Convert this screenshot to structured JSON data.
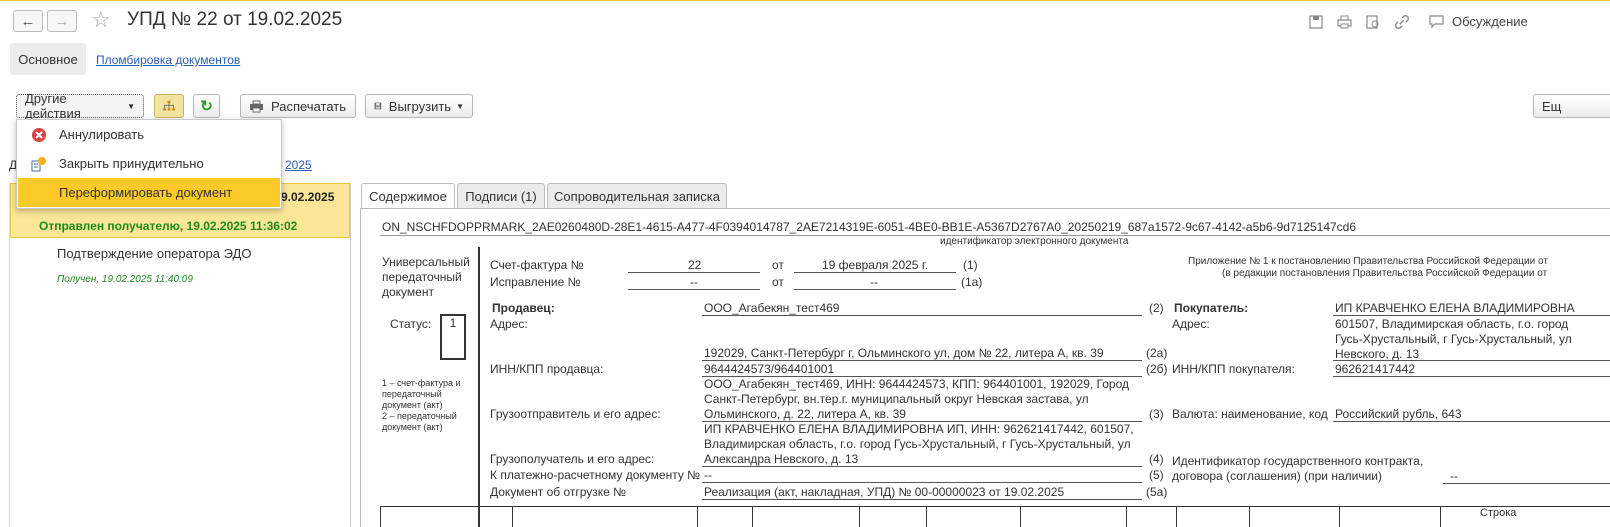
{
  "header": {
    "title": "УПД № 22 от 19.02.2025",
    "discussion": "Обсуждение"
  },
  "nav": {
    "back_glyph": "←",
    "forward_glyph": "→",
    "star_glyph": "☆"
  },
  "tabs": {
    "main": "Основное",
    "sealing": "Пломбировка документов"
  },
  "toolbar": {
    "more_actions": "Другие действия",
    "print": "Распечатать",
    "export": "Выгрузить",
    "right_truncated": "Ещ"
  },
  "menu": {
    "items": [
      "Аннулировать",
      "Закрыть принудительно",
      "Переформировать документ"
    ]
  },
  "left": {
    "partial_top": "Д",
    "partial_link": "2025",
    "selected_partial": "9.02.2025",
    "selected_status": "Отправлен получателю, 19.02.2025 11:36:02",
    "item2_title": "Подтверждение оператора ЭДО",
    "item2_status": "Получен, 19.02.2025 11:40:09"
  },
  "doc_tabs": [
    "Содержимое",
    "Подписи (1)",
    "Сопроводительная записка"
  ],
  "doc": {
    "file_id": "ON_NSCHFDOPPRMARK_2AE0260480D-28E1-4615-A477-4F0394014787_2AE7214319E-6051-4BE0-BB1E-A5367D2767A0_20250219_687a1572-9c67-4142-a5b6-9d7125147cd6",
    "file_id_caption": "идентификатор электронного документа",
    "doc_type": [
      "Универсальный",
      "передаточный",
      "документ"
    ],
    "status_label": "Статус:",
    "status_value": "1",
    "status_note": [
      "1 – счет-фактура и",
      "передаточный",
      "документ (акт)",
      "2 – передаточный",
      "документ (акт)"
    ],
    "invoice_label": "Счет-фактура №",
    "invoice_no": "22",
    "from": "от",
    "invoice_date": "19 февраля 2025 г.",
    "code1": "(1)",
    "correction_label": "Исправление №",
    "correction_no": "--",
    "correction_date": "--",
    "code1a": "(1а)",
    "appendix1": "Приложение № 1 к постановлению Правительства Российской Федерации от",
    "appendix2": "(в редакции постановления Правительства Российской Федерации от",
    "seller_label": "Продавец:",
    "seller": "ООО_Агабекян_тест469",
    "code2": "(2)",
    "address_label": "Адрес:",
    "seller_address": "192029, Санкт-Петербург г, Ольминского ул, дом № 22, литера А, кв. 39",
    "code2a": "(2а)",
    "seller_inn_label": "ИНН/КПП продавца:",
    "seller_inn": "9644424573/964401001",
    "code2b": "(2б)",
    "shipper_label": "Грузоотправитель и его адрес:",
    "shipper": [
      "ООО_Агабекян_тест469, ИНН: 9644424573, КПП: 964401001, 192029, Город",
      "Санкт-Петербург, вн.тер.г. муниципальный округ Невская застава, ул",
      "Ольминского, д. 22, литера А, кв. 39"
    ],
    "code3": "(3)",
    "consignee_label": "Грузополучатель и его адрес:",
    "consignee": [
      "ИП КРАВЧЕНКО ЕЛЕНА ВЛАДИМИРОВНА ИП, ИНН: 962621417442, 601507,",
      "Владимирская область, г.о. город Гусь-Хрустальный, г Гусь-Хрустальный, ул",
      "Александра Невского, д. 13"
    ],
    "code4": "(4)",
    "payment_label": "К платежно-расчетному документу №",
    "payment": "--",
    "code5": "(5)",
    "shipment_label": "Документ об отгрузке №",
    "shipment": "Реализация (акт, накладная, УПД) № 00-00000023 от 19.02.2025",
    "code5a": "(5а)",
    "buyer_label": "Покупатель:",
    "buyer": "ИП КРАВЧЕНКО ЕЛЕНА ВЛАДИМИРОВНА",
    "buyer_address_label": "Адрес:",
    "buyer_address": [
      "601507, Владимирская область, г.о. город",
      "Гусь-Хрустальный, г Гусь-Хрустальный, ул",
      "Невского, д. 13"
    ],
    "buyer_inn_label": "ИНН/КПП покупателя:",
    "buyer_inn": "962621417442",
    "currency_label": "Валюта: наименование, код",
    "currency": "Российский рубль, 643",
    "contract_label": [
      "Идентификатор государственного контракта,",
      "договора (соглашения) (при наличии)"
    ],
    "contract": "--",
    "table_header_partial": "Строка"
  },
  "colors": {
    "accent": "#f0c830",
    "selected_bg": "#fbe596",
    "menu_highlight": "#fbc928",
    "link": "#2a5db0",
    "green": "#1d8a1d",
    "cancel_red": "#e04040"
  }
}
